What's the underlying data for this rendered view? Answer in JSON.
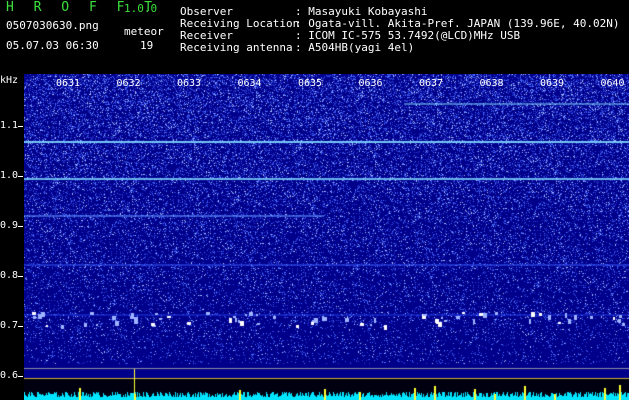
{
  "app": {
    "title": "H R O F F T",
    "version": "1.0.0",
    "filename": "0507030630.png",
    "datetime": "05.07.03 06:30",
    "meteor_label": "meteor",
    "meteor_count": "19"
  },
  "info": {
    "observer_label": "Observer",
    "observer_value": ": Masayuki Kobayashi",
    "location_label": "Receiving Location",
    "location_value": ": Ogata-vill. Akita-Pref. JAPAN (139.96E, 40.02N)",
    "receiver_label": "Receiver",
    "receiver_value": ": ICOM IC-575 53.7492(@LCD)MHz USB",
    "antenna_label": "Receiving antenna",
    "antenna_value": ": A504HB(yagi 4el)"
  },
  "axis": {
    "unit": "kHz",
    "freq_labels": [
      "1.1",
      "1.0",
      "0.9",
      "0.8",
      "0.7",
      "0.6"
    ],
    "time_labels": [
      "0631",
      "0632",
      "0633",
      "0634",
      "0635",
      "0636",
      "0637",
      "0638",
      "0639",
      "0640"
    ]
  },
  "colors": {
    "background": "#00008a",
    "noise": "#4a6cff",
    "line": "#7fd9ff",
    "signal": "#ffffff",
    "spectrum": "#00e5ff",
    "spike": "#ffff33"
  }
}
